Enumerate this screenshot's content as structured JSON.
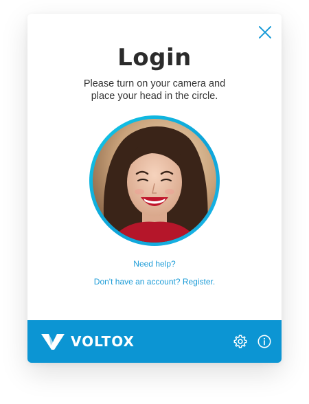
{
  "login": {
    "title": "Login",
    "instruction_line1": "Please turn on your camera and",
    "instruction_line2": "place your head in the circle.",
    "help_link": "Need help?",
    "register_link": "Don't have an account? Register."
  },
  "footer": {
    "brand_name": "VOLTOX",
    "settings_icon": "gear-icon",
    "info_icon": "info-icon"
  },
  "icons": {
    "close": "close-icon"
  },
  "colors": {
    "accent": "#1a9bd7",
    "footer_bg": "#0c95d3",
    "camera_ring": "#12c7e6",
    "title_text": "#2b2b2b"
  }
}
